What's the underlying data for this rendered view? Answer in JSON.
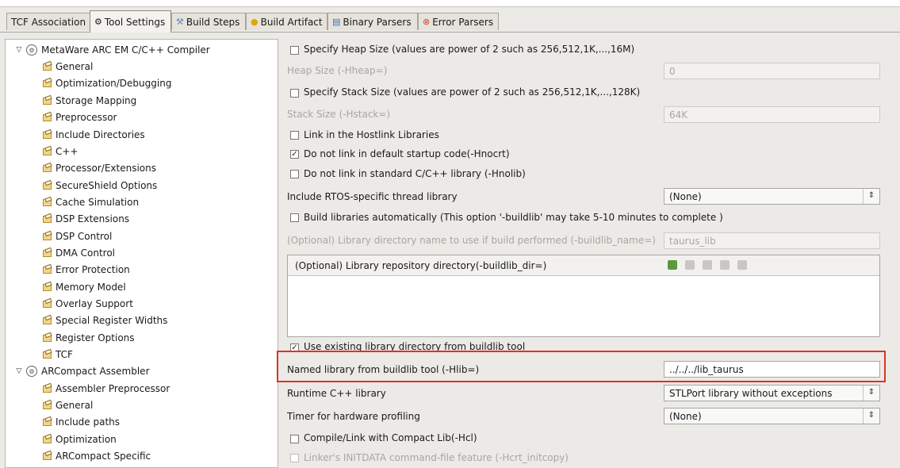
{
  "tabs": [
    {
      "label": "TCF Association",
      "icon": ""
    },
    {
      "label": "Tool Settings",
      "icon": "gear-icon"
    },
    {
      "label": "Build Steps",
      "icon": "build-steps-icon"
    },
    {
      "label": "Build Artifact",
      "icon": "artifact-icon"
    },
    {
      "label": "Binary Parsers",
      "icon": "binary-icon"
    },
    {
      "label": "Error Parsers",
      "icon": "error-icon"
    }
  ],
  "tree": [
    {
      "label": "MetaWare ARC EM C/C++ Compiler",
      "type": "tool"
    },
    {
      "label": "General",
      "type": "page"
    },
    {
      "label": "Optimization/Debugging",
      "type": "page"
    },
    {
      "label": "Storage Mapping",
      "type": "page"
    },
    {
      "label": "Preprocessor",
      "type": "page"
    },
    {
      "label": "Include Directories",
      "type": "page"
    },
    {
      "label": "C++",
      "type": "page"
    },
    {
      "label": "Processor/Extensions",
      "type": "page"
    },
    {
      "label": "SecureShield Options",
      "type": "page"
    },
    {
      "label": "Cache Simulation",
      "type": "page"
    },
    {
      "label": "DSP Extensions",
      "type": "page"
    },
    {
      "label": "DSP Control",
      "type": "page"
    },
    {
      "label": "DMA Control",
      "type": "page"
    },
    {
      "label": "Error Protection",
      "type": "page"
    },
    {
      "label": "Memory Model",
      "type": "page"
    },
    {
      "label": "Overlay Support",
      "type": "page"
    },
    {
      "label": "Special Register Widths",
      "type": "page"
    },
    {
      "label": "Register Options",
      "type": "page"
    },
    {
      "label": "TCF",
      "type": "page"
    },
    {
      "label": "ARCompact Assembler",
      "type": "tool"
    },
    {
      "label": "Assembler Preprocessor",
      "type": "page"
    },
    {
      "label": "General",
      "type": "page"
    },
    {
      "label": "Include paths",
      "type": "page"
    },
    {
      "label": "Optimization",
      "type": "page"
    },
    {
      "label": "ARCompact Specific",
      "type": "page"
    }
  ],
  "settings": {
    "heap_cb": "Specify Heap Size (values are power of 2 such as 256,512,1K,...,16M)",
    "heap_label": "Heap Size (-Hheap=)",
    "heap_value": "0",
    "stack_cb": "Specify Stack Size (values are power of 2 such as 256,512,1K,...,128K)",
    "stack_label": "Stack Size (-Hstack=)",
    "stack_value": "64K",
    "hostlink_cb": "Link in the Hostlink Libraries",
    "nocrt_cb": "Do not link in default startup code(-Hnocrt)",
    "nolib_cb": "Do not link in standard C/C++ library (-Hnolib)",
    "rtos_label": "Include RTOS-specific thread library",
    "rtos_value": "(None)",
    "buildlib_cb": "Build libraries automatically (This option '-buildlib' may take 5-10 minutes to complete )",
    "buildlib_name_label": "(Optional) Library directory name to use if build performed (-buildlib_name=)",
    "buildlib_name_value": "taurus_lib",
    "repo_label": "(Optional) Library repository directory(-buildlib_dir=)",
    "use_existing_cb": "Use existing library directory from buildlib tool",
    "named_lib_label": "Named library from buildlib tool (-Hlib=)",
    "named_lib_value": "../../../lib_taurus",
    "runtime_label": "Runtime C++ library",
    "runtime_value": "STLPort library without exceptions",
    "timer_label": "Timer for hardware profiling",
    "timer_value": "(None)",
    "compact_cb": "Compile/Link with Compact Lib(-Hcl)",
    "initdata_cb": "Linker's INITDATA command-file feature (-Hcrt_initcopy)"
  },
  "checks": {
    "heap": false,
    "stack": false,
    "hostlink": false,
    "nocrt": true,
    "nolib": false,
    "buildlib": false,
    "use_existing": true,
    "compact": false,
    "initdata": false
  },
  "colors": {
    "highlight": "#e03124"
  }
}
